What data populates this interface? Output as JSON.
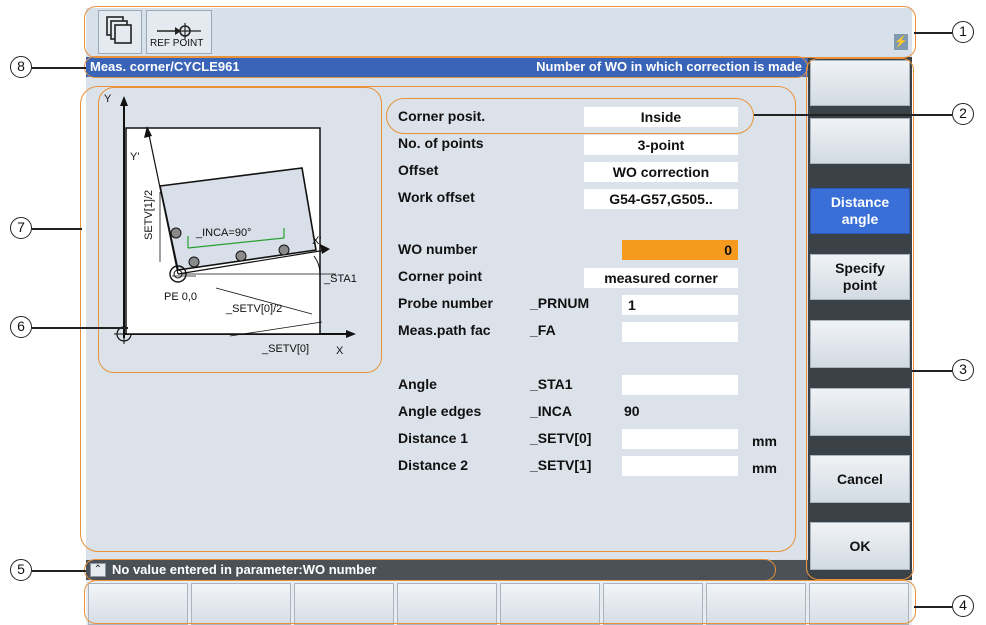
{
  "toolbar": {
    "ref_point_label": "REF POINT"
  },
  "title": {
    "left": "Meas. corner/CYCLE961",
    "right": "Number of WO in which correction is made"
  },
  "diagram": {
    "y_axis": "Y",
    "x_axis": "X",
    "y_prime": "Y'",
    "x_prime": "X'",
    "inca": "_INCA=90°",
    "sta1": "_STA1",
    "origin": "PE 0,0",
    "setv1_2": "SETV[1]/2",
    "setv0_2": "_SETV[0]/2",
    "setv0": "_SETV[0]"
  },
  "form": {
    "corner_posit": {
      "label": "Corner posit.",
      "value": "Inside"
    },
    "no_points": {
      "label": "No. of points",
      "value": "3-point"
    },
    "offset": {
      "label": "Offset",
      "value": "WO correction"
    },
    "work_offset": {
      "label": "Work offset",
      "value": "G54-G57,G505.."
    },
    "wo_number": {
      "label": "WO number",
      "value": "0"
    },
    "corner_point": {
      "label": "Corner point",
      "value": "measured corner"
    },
    "probe_number": {
      "label": "Probe number",
      "param": "_PRNUM",
      "value": "1"
    },
    "meas_path": {
      "label": "Meas.path fac",
      "param": "_FA",
      "value": ""
    },
    "angle": {
      "label": "Angle",
      "param": "_STA1",
      "value": ""
    },
    "angle_edges": {
      "label": "Angle edges",
      "param": "_INCA",
      "value": "90"
    },
    "distance1": {
      "label": "Distance 1",
      "param": "_SETV[0]",
      "value": "",
      "unit": "mm"
    },
    "distance2": {
      "label": "Distance 2",
      "param": "_SETV[1]",
      "value": "",
      "unit": "mm"
    }
  },
  "softkeys": {
    "distance_angle": "Distance angle",
    "specify_point": "Specify point",
    "cancel": "Cancel",
    "ok": "OK"
  },
  "status": {
    "message": "No value entered in parameter:WO number"
  },
  "callouts": [
    "1",
    "2",
    "3",
    "4",
    "5",
    "6",
    "7",
    "8"
  ],
  "colors": {
    "title_bar": "#3a64b8",
    "active_softkey": "#3a6fd8",
    "highlight_field": "#f59a1c",
    "callout_oval": "#e8923a"
  }
}
